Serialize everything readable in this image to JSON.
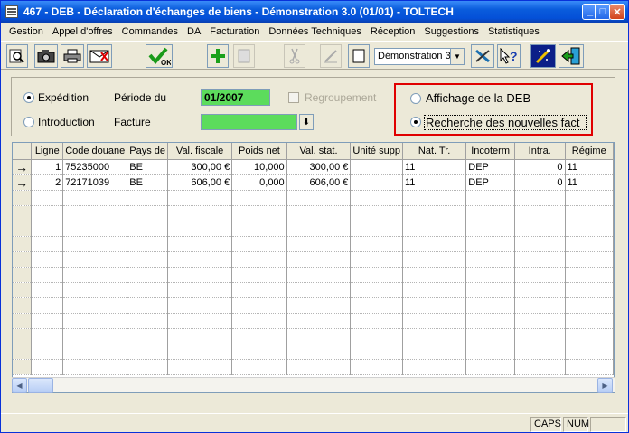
{
  "window": {
    "title": "467 - DEB - Déclaration d'échanges de biens - Démonstration 3.0 (01/01) - TOLTECH"
  },
  "menu": [
    "Gestion",
    "Appel d'offres",
    "Commandes",
    "DA",
    "Facturation",
    "Données Techniques",
    "Réception",
    "Suggestions",
    "Statistiques"
  ],
  "toolbar": {
    "combo_value": "Démonstration 3",
    "ok_label": "OK"
  },
  "form": {
    "expedition_label": "Expédition",
    "introduction_label": "Introduction",
    "periode_label": "Période du",
    "periode_value": "01/2007",
    "facture_label": "Facture",
    "facture_value": "",
    "regroupement_label": "Regroupement",
    "affichage_label": "Affichage de la DEB",
    "recherche_label": "Recherche des nouvelles fact",
    "selected_type": "expedition",
    "selected_mode": "recherche"
  },
  "grid": {
    "columns": [
      "Ligne",
      "Code douane",
      "Pays de",
      "Val. fiscale",
      "Poids net",
      "Val. stat.",
      "Unité supp",
      "Nat. Tr.",
      "Incoterm",
      "Intra.",
      "Régime"
    ],
    "rows": [
      [
        "1",
        "75235000",
        "BE",
        "300,00 €",
        "10,000",
        "300,00 €",
        "",
        "11",
        "DEP",
        "0",
        "11"
      ],
      [
        "2",
        "72171039",
        "BE",
        "606,00 €",
        "0,000",
        "606,00 €",
        "",
        "11",
        "DEP",
        "0",
        "11"
      ]
    ],
    "row_marker": "→"
  },
  "status": {
    "caps": "CAPS",
    "num": "NUM"
  },
  "colors": {
    "title_bar": "#0a5cdc",
    "field_green": "#5cdc5c",
    "highlight_red": "#e00000"
  }
}
